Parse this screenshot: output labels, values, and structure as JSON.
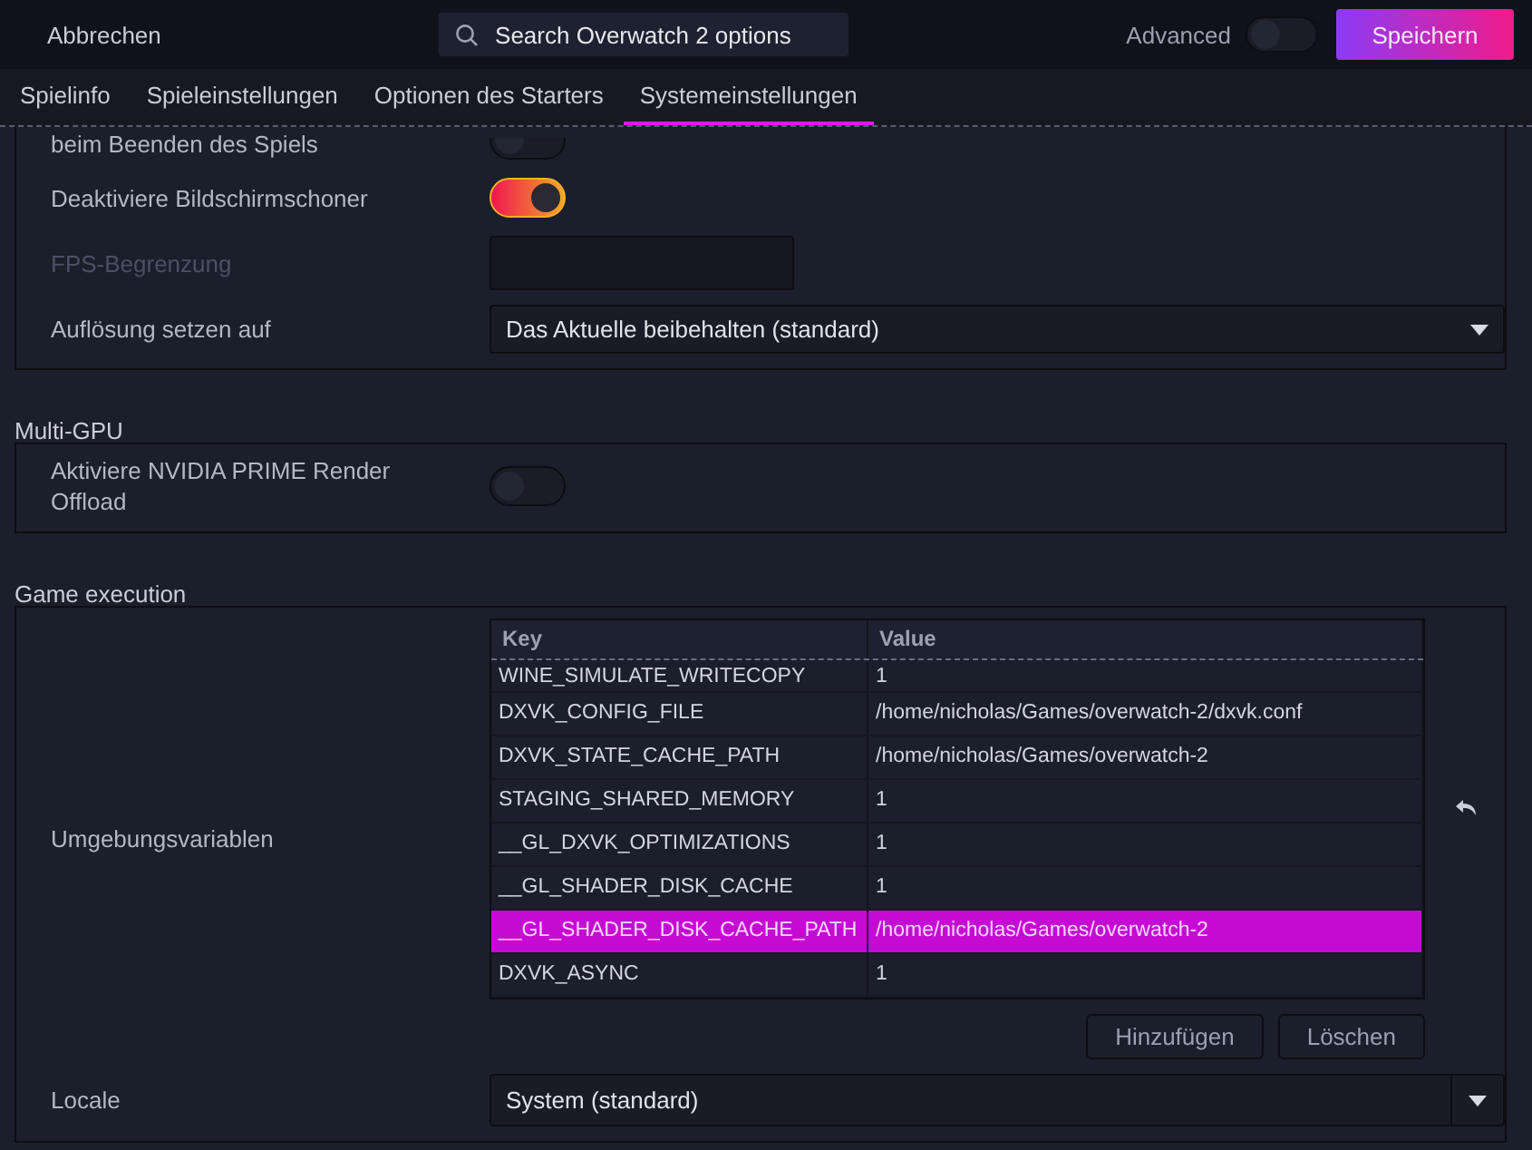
{
  "header": {
    "cancel": "Abbrechen",
    "search": {
      "placeholder": "Search Overwatch 2 options"
    },
    "advanced": {
      "label": "Advanced",
      "on": false
    },
    "save": "Speichern"
  },
  "tabs": [
    {
      "label": "Spielinfo",
      "selected": false
    },
    {
      "label": "Spieleinstellungen",
      "selected": false
    },
    {
      "label": "Optionen des Starters",
      "selected": false
    },
    {
      "label": "Systemeinstellungen",
      "selected": true
    }
  ],
  "sections": [
    {
      "rows": [
        {
          "kind": "toggle",
          "label": "beim Beenden des Spiels",
          "on": false
        },
        {
          "kind": "toggle",
          "label": "Deaktiviere Bildschirmschoner",
          "on": true
        },
        {
          "kind": "input",
          "label": "FPS-Begrenzung",
          "disabled": true
        },
        {
          "kind": "select",
          "label": "Auflösung setzen auf",
          "value": "Das Aktuelle beibehalten (standard)"
        }
      ]
    },
    {
      "title": "Multi-GPU",
      "rows": [
        {
          "kind": "toggle",
          "label": "Aktiviere NVIDIA PRIME Render Offload",
          "on": false
        }
      ]
    },
    {
      "title": "Game execution",
      "rows": [
        {
          "kind": "table",
          "label": "Umgebungsvariablen",
          "columns": [
            "Key",
            "Value"
          ],
          "rows": [
            {
              "key": "WINE_SIMULATE_WRITECOPY",
              "value": "1",
              "selected": false
            },
            {
              "key": "DXVK_CONFIG_FILE",
              "value": "/home/nicholas/Games/overwatch-2/dxvk.conf",
              "selected": false
            },
            {
              "key": "DXVK_STATE_CACHE_PATH",
              "value": "/home/nicholas/Games/overwatch-2",
              "selected": false
            },
            {
              "key": "STAGING_SHARED_MEMORY",
              "value": "1",
              "selected": false
            },
            {
              "key": "__GL_DXVK_OPTIMIZATIONS",
              "value": "1",
              "selected": false
            },
            {
              "key": "__GL_SHADER_DISK_CACHE",
              "value": "1",
              "selected": false
            },
            {
              "key": "__GL_SHADER_DISK_CACHE_PATH",
              "value": "/home/nicholas/Games/overwatch-2",
              "selected": true
            },
            {
              "key": "DXVK_ASYNC",
              "value": "1",
              "selected": false
            }
          ],
          "buttons": [
            "Hinzufügen",
            "Löschen"
          ]
        },
        {
          "kind": "combo",
          "label": "Locale",
          "value": "System (standard)"
        }
      ]
    }
  ]
}
